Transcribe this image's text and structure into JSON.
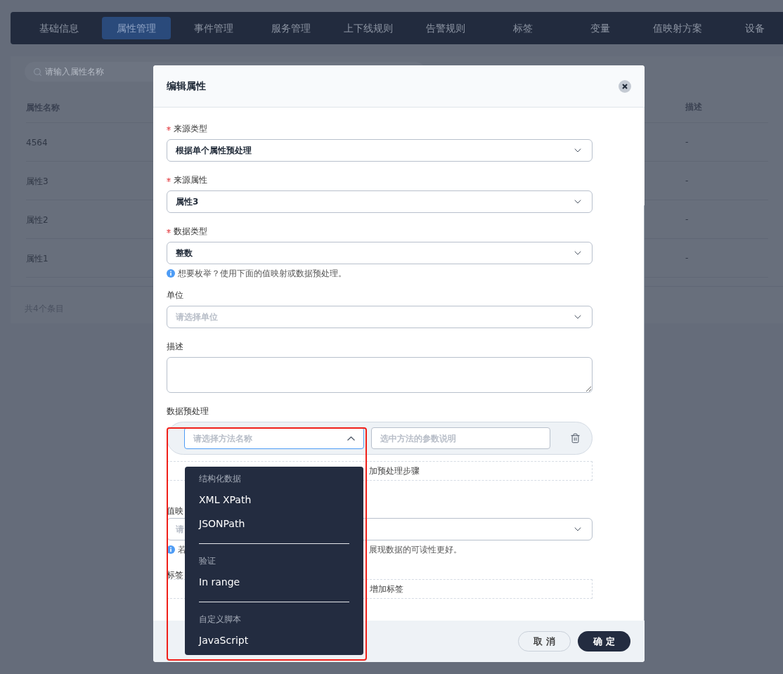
{
  "nav": {
    "tabs": [
      {
        "label": "基础信息",
        "selected": false
      },
      {
        "label": "属性管理",
        "selected": true
      },
      {
        "label": "事件管理",
        "selected": false
      },
      {
        "label": "服务管理",
        "selected": false
      },
      {
        "label": "上下线规则",
        "selected": false
      },
      {
        "label": "告警规则",
        "selected": false
      },
      {
        "label": "标签",
        "selected": false
      },
      {
        "label": "变量",
        "selected": false
      },
      {
        "label": "值映射方案",
        "selected": false
      },
      {
        "label": "设备",
        "selected": false
      }
    ]
  },
  "search": {
    "placeholder": "请输入属性名称"
  },
  "table": {
    "columns": [
      "属性名称",
      "描述"
    ],
    "rows": [
      {
        "name": "4564",
        "description": "-"
      },
      {
        "name": "属性3",
        "description": "-"
      },
      {
        "name": "属性2",
        "description": "-"
      },
      {
        "name": "属性1",
        "description": "-"
      }
    ],
    "footer": "共4个条目"
  },
  "dialog": {
    "title": "编辑属性",
    "fields": [
      {
        "kind": "select",
        "label": "来源类型",
        "required": true,
        "value": "根据单个属性预处理"
      },
      {
        "kind": "select",
        "label": "来源属性",
        "required": true,
        "value": "属性3"
      },
      {
        "kind": "select",
        "label": "数据类型",
        "required": true,
        "value": "整数",
        "hint": "想要枚举？使用下面的值映射或数据预处理。"
      },
      {
        "kind": "select",
        "label": "单位",
        "required": false,
        "placeholder": "请选择单位"
      },
      {
        "kind": "textarea",
        "label": "描述"
      }
    ],
    "preprocessing": {
      "label": "数据预处理",
      "method_placeholder": "请选择方法名称",
      "param_placeholder": "选中方法的参数说明",
      "add_step": "加预处理步骤",
      "open": true,
      "menu": [
        {
          "title": "结构化数据",
          "options": [
            "XML XPath",
            "JSONPath"
          ]
        },
        {
          "title": "验证",
          "options": [
            "In range"
          ]
        },
        {
          "title": "自定义脚本",
          "options": [
            "JavaScript"
          ]
        }
      ]
    },
    "value_mapping": {
      "label": "值映",
      "placeholder": "请",
      "hint_start": "若",
      "hint_end": "展现数据的可读性更好。"
    },
    "tags": {
      "label": "标签",
      "add": "增加标签"
    },
    "buttons": [
      {
        "kind": "secondary",
        "label": "取 消"
      },
      {
        "kind": "primary",
        "label": "确 定"
      }
    ]
  }
}
